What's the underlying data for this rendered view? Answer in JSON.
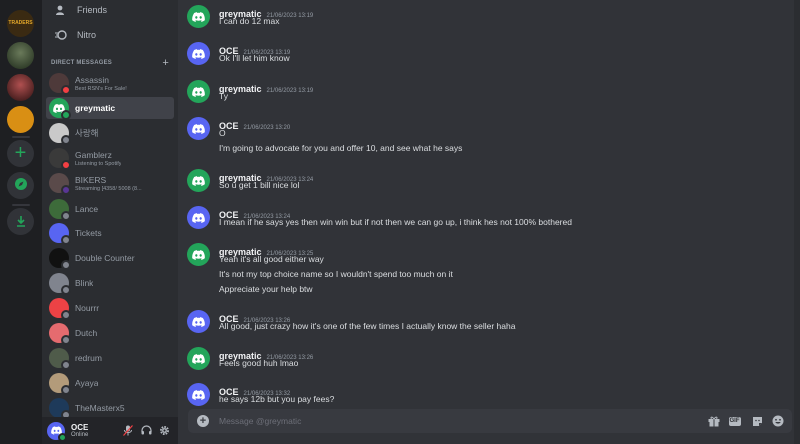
{
  "nav": {
    "friends_label": "Friends",
    "nitro_label": "Nitro",
    "direct_messages_header": "DIRECT MESSAGES",
    "add_dm_label": "+"
  },
  "servers": [
    {
      "name": "server-traders",
      "text": "TRADERS",
      "color": "#3a2a12"
    },
    {
      "name": "server-2",
      "text": "",
      "color": "#2f3b2a"
    },
    {
      "name": "server-3",
      "text": "",
      "color": "#3b2a2a"
    },
    {
      "name": "server-4",
      "text": "",
      "color": "#d98f14"
    }
  ],
  "dm_list": [
    {
      "name": "Assassin",
      "sub": "Best RSN's For Sale!",
      "status": "#f23f43",
      "avatar_color": "#4e3a3a",
      "active": false
    },
    {
      "name": "greymatic",
      "sub": "",
      "status": "#23a55a",
      "avatar_color": "#23a55a",
      "active": true
    },
    {
      "name": "사랑해",
      "sub": "",
      "status": "#80848e",
      "avatar_color": "#c9c9c9",
      "active": false
    },
    {
      "name": "Gamblerz",
      "sub": "Listening to Spotify",
      "status": "#f23f43",
      "avatar_color": "#3a3a3a",
      "active": false
    },
    {
      "name": "BIKERS",
      "sub": "Streaming [4358/ 5008 (8...",
      "status": "#593695",
      "avatar_color": "#5a4a4a",
      "active": false
    },
    {
      "name": "Lance",
      "sub": "",
      "status": "#80848e",
      "avatar_color": "#3d6b3a",
      "active": false
    },
    {
      "name": "Tickets",
      "sub": "",
      "status": "#80848e",
      "avatar_color": "#5865f2",
      "active": false
    },
    {
      "name": "Double Counter",
      "sub": "",
      "status": "#80848e",
      "avatar_color": "#111111",
      "active": false
    },
    {
      "name": "Blink",
      "sub": "",
      "status": "#80848e",
      "avatar_color": "#80848e",
      "active": false
    },
    {
      "name": "Nourrr",
      "sub": "",
      "status": "#80848e",
      "avatar_color": "#ed4245",
      "active": false
    },
    {
      "name": "Dutch",
      "sub": "",
      "status": "#80848e",
      "avatar_color": "#e56b6f",
      "active": false
    },
    {
      "name": "redrum",
      "sub": "",
      "status": "#80848e",
      "avatar_color": "#4f5b4a",
      "active": false
    },
    {
      "name": "Ayaya",
      "sub": "",
      "status": "#80848e",
      "avatar_color": "#b39b7a",
      "active": false
    },
    {
      "name": "TheMasterx5",
      "sub": "",
      "status": "#80848e",
      "avatar_color": "#1e3a5a",
      "active": false
    }
  ],
  "user": {
    "name": "OCE",
    "status": "Online"
  },
  "messages": [
    {
      "author": "greymatic",
      "time": "21/06/2023 13:19",
      "avatar": "green",
      "lines": [
        "I can do 12 max"
      ]
    },
    {
      "author": "OCE",
      "time": "21/06/2023 13:19",
      "avatar": "blue",
      "lines": [
        "Ok I'll let him know"
      ]
    },
    {
      "author": "greymatic",
      "time": "21/06/2023 13:19",
      "avatar": "green",
      "lines": [
        "Ty"
      ]
    },
    {
      "author": "OCE",
      "time": "21/06/2023 13:20",
      "avatar": "blue",
      "lines": [
        "O",
        "I'm going to advocate for you and offer 10, and see what he says"
      ]
    },
    {
      "author": "greymatic",
      "time": "21/06/2023 13:24",
      "avatar": "green",
      "lines": [
        "So u get 1 bill nice lol"
      ]
    },
    {
      "author": "OCE",
      "time": "21/06/2023 13:24",
      "avatar": "blue",
      "lines": [
        "I mean if he says yes then win win but if not then we can go up, i think hes not 100% bothered"
      ]
    },
    {
      "author": "greymatic",
      "time": "21/06/2023 13:25",
      "avatar": "green",
      "lines": [
        "Yeah it's all good either way",
        "It's not my top choice name so I wouldn't spend too much on it",
        "Appreciate your help btw"
      ]
    },
    {
      "author": "OCE",
      "time": "21/06/2023 13:26",
      "avatar": "blue",
      "lines": [
        "All good, just crazy how it's one of the few times I actually know the seller haha"
      ]
    },
    {
      "author": "greymatic",
      "time": "21/06/2023 13:26",
      "avatar": "green",
      "lines": [
        "Feels good huh lmao"
      ]
    },
    {
      "author": "OCE",
      "time": "21/06/2023 13:32",
      "avatar": "blue",
      "lines": [
        "he says 12b but you pay fees?"
      ]
    }
  ],
  "composer": {
    "placeholder": "Message @greymatic",
    "gif_label": "GIF"
  },
  "colors": {
    "accent": "#5865f2",
    "online": "#23a55a",
    "dnd": "#f23f43"
  }
}
